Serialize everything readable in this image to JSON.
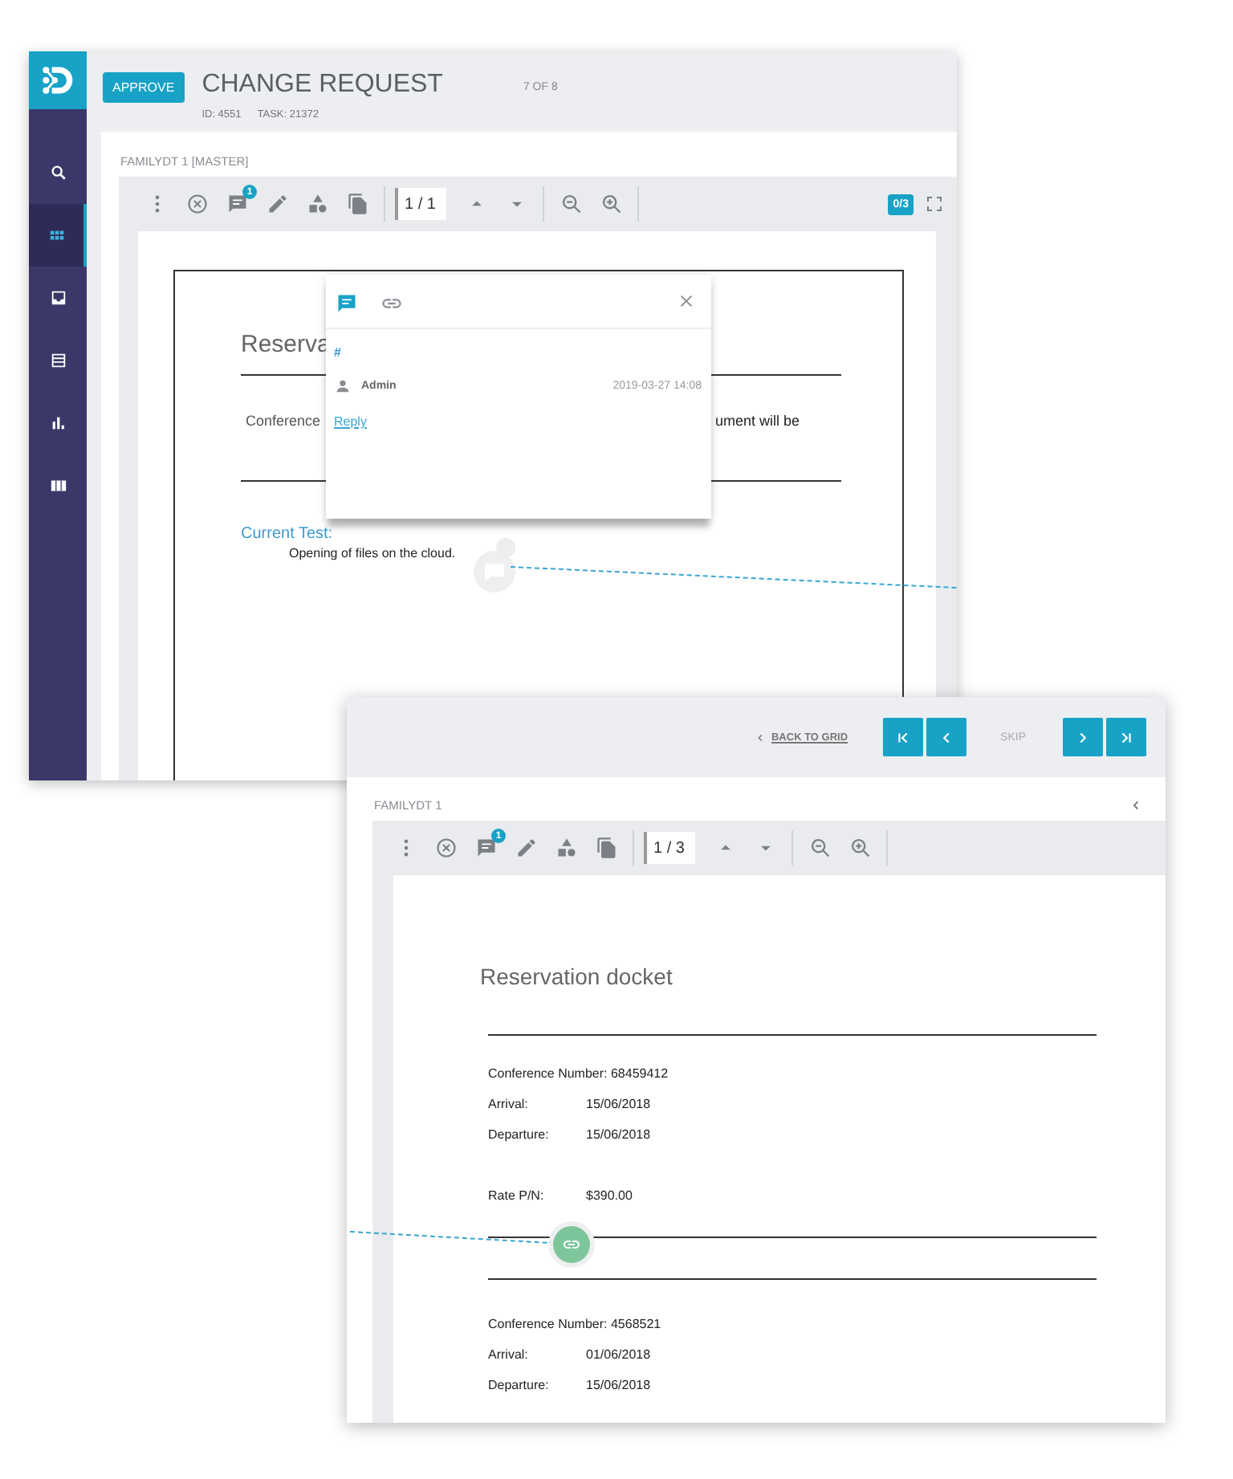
{
  "change_request": {
    "sidebar": [
      {
        "kind": "search",
        "selected": false
      },
      {
        "kind": "grid",
        "selected": true
      },
      {
        "kind": "inbox",
        "selected": false
      },
      {
        "kind": "list",
        "selected": false
      },
      {
        "kind": "chart",
        "selected": false
      },
      {
        "kind": "columns",
        "selected": false
      }
    ],
    "approve_button": "APPROVE",
    "title": "CHANGE REQUEST",
    "position": "7 OF 8",
    "id": "ID: 4551",
    "task": "TASK: 21372",
    "document_name": "FAMILYDT 1 [MASTER]",
    "toolbar": {
      "comment_badge": "1",
      "page": "1 / 1",
      "annotation_count": "0/3"
    },
    "page": {
      "title": "Reserva",
      "line_start": "Conference",
      "line_end": "ument will be",
      "section": "Current Test:",
      "note": "Opening of files on the cloud."
    },
    "comment_popup": {
      "tabs": [
        {
          "kind": "comment",
          "selected": true
        },
        {
          "kind": "link",
          "selected": false
        }
      ],
      "tag": "#",
      "author": "Admin",
      "date": "2019-03-27 14:08",
      "reply_link": "Reply"
    }
  },
  "review": {
    "back_link": "BACK TO GRID",
    "skip": "SKIP",
    "document_name": "FAMILYDT 1",
    "toolbar": {
      "comment_badge": "1",
      "page": "1 / 3"
    },
    "page": {
      "title": "Reservation docket",
      "groups": [
        {
          "rows": [
            {
              "text": "Conference Number: 68459412"
            },
            {
              "label": "Arrival:",
              "value": "15/06/2018"
            },
            {
              "label": "Departure:",
              "value": "15/06/2018"
            }
          ]
        },
        {
          "rows": [
            {
              "label": "Rate P/N:",
              "value": "$390.00"
            }
          ]
        },
        {
          "rows": [
            {
              "text": "Conference Number: 4568521"
            },
            {
              "label": "Arrival:",
              "value": "01/06/2018"
            },
            {
              "label": "Departure:",
              "value": "15/06/2018"
            }
          ]
        }
      ]
    }
  }
}
